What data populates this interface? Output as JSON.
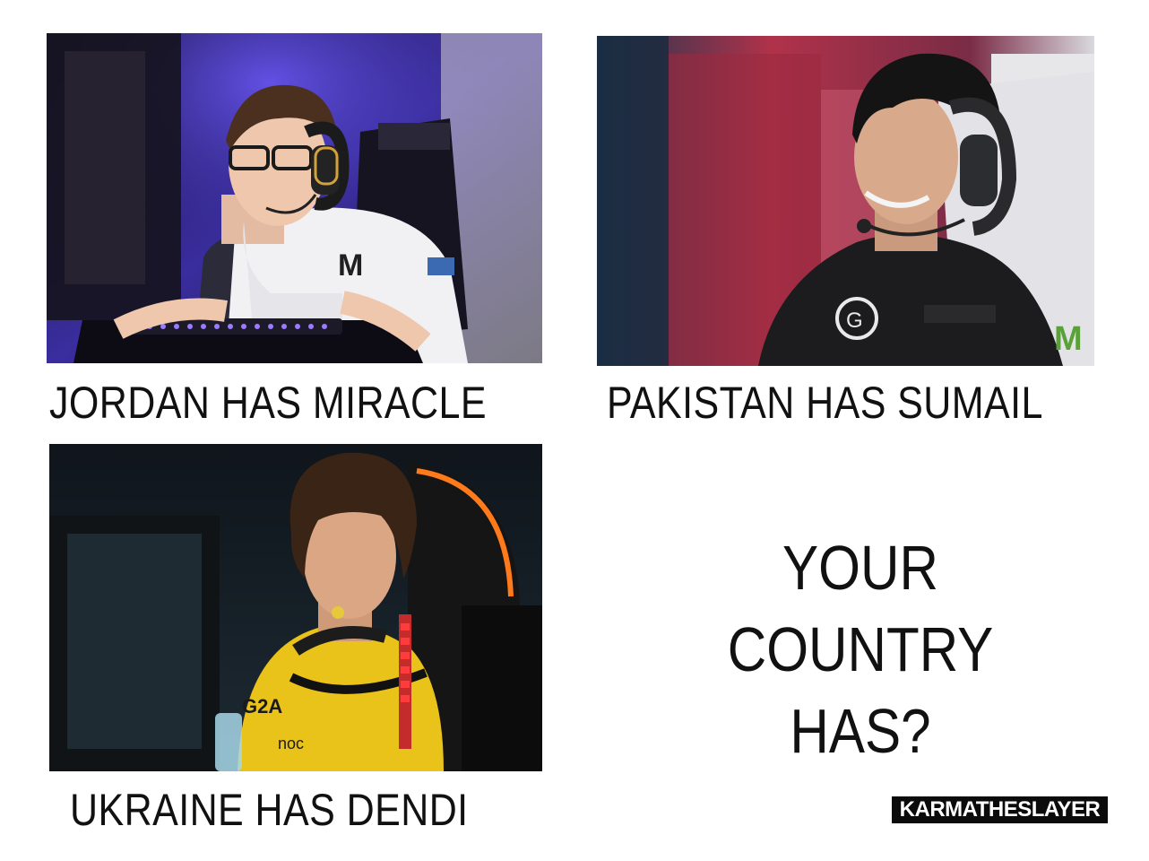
{
  "panels": [
    {
      "caption": "JORDAN HAS MIRACLE",
      "scene": "player-wearing-glasses-and-headset-at-keyboard",
      "colors": {
        "backdrop": "#3a2d9e",
        "jersey": "#f1f1f4",
        "accent": "#7c5cff"
      }
    },
    {
      "caption": "PAKISTAN HAS SUMAIL",
      "scene": "smiling-player-with-headset-in-dark-hoodie",
      "colors": {
        "backdrop": "#b0324a",
        "hoodie": "#1c1c1e",
        "accent": "#d9415e"
      }
    },
    {
      "caption": "UKRAINE HAS DENDI",
      "scene": "player-with-headphones-around-neck-in-yellow-jersey",
      "colors": {
        "backdrop": "#1d2a33",
        "jersey": "#e9c21a",
        "accent": "#ff7a1a"
      }
    }
  ],
  "question": {
    "line1": "YOUR COUNTRY",
    "line2": "HAS?"
  },
  "watermark": "KARMATHESLAYER"
}
